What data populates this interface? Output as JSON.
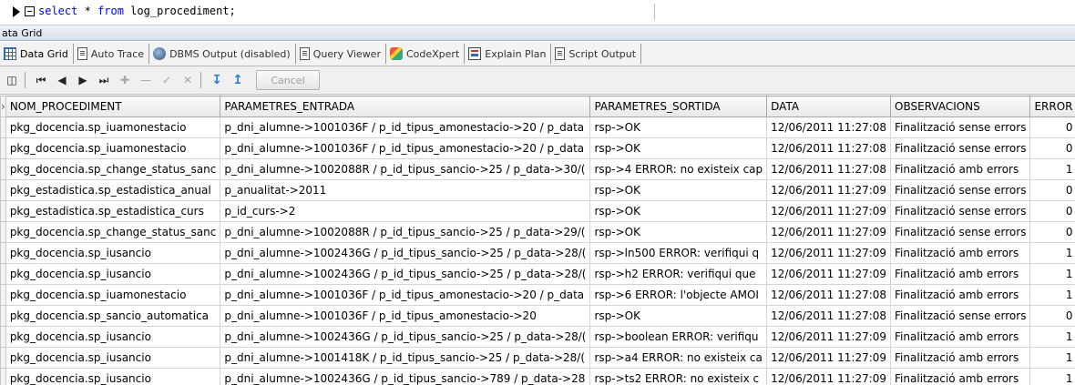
{
  "editor": {
    "kw1": "select",
    "rest1": " * ",
    "kw2": "from",
    "rest2": " log_procediment;"
  },
  "panel": {
    "title": "ata Grid"
  },
  "tabs": [
    {
      "label": "Data Grid",
      "icon": "grid-icon"
    },
    {
      "label": "Auto Trace",
      "icon": "doc-icon"
    },
    {
      "label": "DBMS Output (disabled)",
      "icon": "dbms-icon"
    },
    {
      "label": "Query Viewer",
      "icon": "doc-icon"
    },
    {
      "label": "CodeXpert",
      "icon": "codexpert-icon"
    },
    {
      "label": "Explain Plan",
      "icon": "plan-icon"
    },
    {
      "label": "Script Output",
      "icon": "doc-icon"
    }
  ],
  "toolbar": {
    "cancel_label": "Cancel"
  },
  "grid": {
    "columns": [
      "NOM_PROCEDIMENT",
      "PARAMETRES_ENTRADA",
      "PARAMETRES_SORTIDA",
      "DATA",
      "OBSERVACIONS",
      "ERROR"
    ],
    "rows": [
      [
        "pkg_docencia.sp_iuamonestacio",
        "p_dni_alumne->1001036F / p_id_tipus_amonestacio->20 / p_data",
        "rsp->OK",
        "12/06/2011 11:27:08",
        "Finalització sense errors",
        "0"
      ],
      [
        "pkg_docencia.sp_iuamonestacio",
        "p_dni_alumne->1001036F / p_id_tipus_amonestacio->20 / p_data",
        "rsp->OK",
        "12/06/2011 11:27:08",
        "Finalització sense errors",
        "0"
      ],
      [
        "pkg_docencia.sp_change_status_sanc",
        "p_dni_alumne->1002088R / p_id_tipus_sancio->25 / p_data->30/(",
        "rsp->4 ERROR: no existeix cap",
        "12/06/2011 11:27:08",
        "Finalització amb errors",
        "1"
      ],
      [
        "pkg_estadistica.sp_estadistica_anual",
        "p_anualitat->2011",
        "rsp->OK",
        "12/06/2011 11:27:09",
        "Finalització sense errors",
        "0"
      ],
      [
        "pkg_estadistica.sp_estadistica_curs",
        "p_id_curs->2",
        "rsp->OK",
        "12/06/2011 11:27:09",
        "Finalització sense errors",
        "0"
      ],
      [
        "pkg_docencia.sp_change_status_sanc",
        "p_dni_alumne->1002088R / p_id_tipus_sancio->25 / p_data->29/(",
        "rsp->OK",
        "12/06/2011 11:27:09",
        "Finalització sense errors",
        "0"
      ],
      [
        "pkg_docencia.sp_iusancio",
        "p_dni_alumne->1002436G / p_id_tipus_sancio->25 / p_data->28/(",
        "rsp->ln500 ERROR: verifiqui q",
        "12/06/2011 11:27:09",
        "Finalització amb errors",
        "1"
      ],
      [
        "pkg_docencia.sp_iusancio",
        "p_dni_alumne->1002436G / p_id_tipus_sancio->25 / p_data->28/(",
        "rsp->h2 ERROR: verifiqui que",
        "12/06/2011 11:27:09",
        "Finalització amb errors",
        "1"
      ],
      [
        "pkg_docencia.sp_iuamonestacio",
        "p_dni_alumne->1001036F / p_id_tipus_amonestacio->20 / p_data",
        "rsp->6 ERROR: l'objecte AMOI",
        "12/06/2011 11:27:08",
        "Finalització amb errors",
        "1"
      ],
      [
        "pkg_docencia.sp_sancio_automatica",
        "p_dni_alumne->1001036F / p_id_tipus_amonestacio->20",
        "rsp->OK",
        "12/06/2011 11:27:08",
        "Finalització sense errors",
        "0"
      ],
      [
        "pkg_docencia.sp_iusancio",
        "p_dni_alumne->1002436G / p_id_tipus_sancio->25 / p_data->28/(",
        "rsp->boolean ERROR: verifiqu",
        "12/06/2011 11:27:09",
        "Finalització amb errors",
        "1"
      ],
      [
        "pkg_docencia.sp_iusancio",
        "p_dni_alumne->1001418K / p_id_tipus_sancio->25 / p_data->28/(",
        "rsp->a4 ERROR: no existeix ca",
        "12/06/2011 11:27:09",
        "Finalització amb errors",
        "1"
      ],
      [
        "pkg_docencia.sp_iusancio",
        "p_dni_alumne->1002436G / p_id_tipus_sancio->789 / p_data->28",
        "rsp->ts2 ERROR: no existeix c",
        "12/06/2011 11:27:09",
        "Finalització amb errors",
        "1"
      ]
    ]
  }
}
